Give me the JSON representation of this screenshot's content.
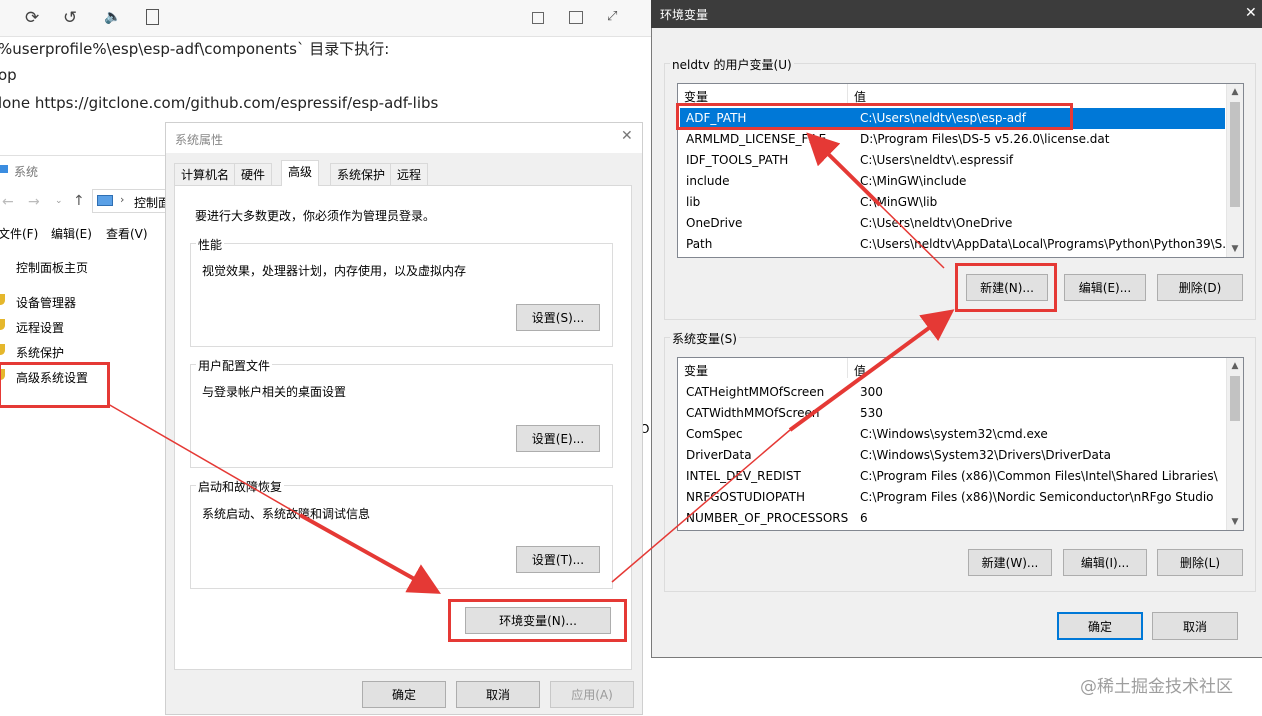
{
  "editor": {
    "toolbar_icons": [
      "refresh-icon",
      "undo-icon",
      "speaker-icon",
      "document-icon",
      "save-icon",
      "split-view-icon",
      "fullscreen-icon"
    ],
    "lines": [
      "%userprofile%\\esp\\esp-adf\\components` 目录下执行:",
      "op",
      "lone https://gitclone.com/github.com/espressif/esp-adf-libs"
    ]
  },
  "control_panel": {
    "title": "系统",
    "address": "控制面",
    "menu": [
      "文件(F)",
      "编辑(E)",
      "查看(V)"
    ],
    "home": "控制面板主页",
    "links": [
      "设备管理器",
      "远程设置",
      "系统保护",
      "高级系统设置"
    ],
    "stray_text": "O"
  },
  "sysprops": {
    "title": "系统属性",
    "tabs": [
      "计算机名",
      "硬件",
      "高级",
      "系统保护",
      "远程"
    ],
    "active_tab": "高级",
    "admin_note": "要进行大多数更改，你必须作为管理员登录。",
    "performance": {
      "title": "性能",
      "desc": "视觉效果，处理器计划，内存使用，以及虚拟内存",
      "button": "设置(S)..."
    },
    "profiles": {
      "title": "用户配置文件",
      "desc": "与登录帐户相关的桌面设置",
      "button": "设置(E)..."
    },
    "startup": {
      "title": "启动和故障恢复",
      "desc": "系统启动、系统故障和调试信息",
      "button": "设置(T)..."
    },
    "env_button": "环境变量(N)...",
    "ok": "确定",
    "cancel": "取消",
    "apply": "应用(A)"
  },
  "envvars": {
    "title": "环境变量",
    "user_group": "neldtv 的用户变量(U)",
    "col_var": "变量",
    "col_val": "值",
    "user_vars": [
      {
        "name": "ADF_PATH",
        "value": "C:\\Users\\neldtv\\esp\\esp-adf"
      },
      {
        "name": "ARMLMD_LICENSE_FILE",
        "value": "D:\\Program Files\\DS-5 v5.26.0\\license.dat"
      },
      {
        "name": "IDF_TOOLS_PATH",
        "value": "C:\\Users\\neldtv\\.espressif"
      },
      {
        "name": "include",
        "value": "C:\\MinGW\\include"
      },
      {
        "name": "lib",
        "value": "C:\\MinGW\\lib"
      },
      {
        "name": "OneDrive",
        "value": "C:\\Users\\neldtv\\OneDrive"
      },
      {
        "name": "Path",
        "value": "C:\\Users\\neldtv\\AppData\\Local\\Programs\\Python\\Python39\\S..."
      }
    ],
    "user_buttons": {
      "new": "新建(N)...",
      "edit": "编辑(E)...",
      "delete": "删除(D)"
    },
    "sys_group": "系统变量(S)",
    "sys_vars": [
      {
        "name": "CATHeightMMOfScreen",
        "value": "300"
      },
      {
        "name": "CATWidthMMOfScreen",
        "value": "530"
      },
      {
        "name": "ComSpec",
        "value": "C:\\Windows\\system32\\cmd.exe"
      },
      {
        "name": "DriverData",
        "value": "C:\\Windows\\System32\\Drivers\\DriverData"
      },
      {
        "name": "INTEL_DEV_REDIST",
        "value": "C:\\Program Files (x86)\\Common Files\\Intel\\Shared Libraries\\"
      },
      {
        "name": "NRFGOSTUDIOPATH",
        "value": "C:\\Program Files (x86)\\Nordic Semiconductor\\nRFgo Studio"
      },
      {
        "name": "NUMBER_OF_PROCESSORS",
        "value": "6"
      }
    ],
    "sys_buttons": {
      "new": "新建(W)...",
      "edit": "编辑(I)...",
      "delete": "删除(L)"
    },
    "ok": "确定",
    "cancel": "取消",
    "close": "✕"
  },
  "watermark": "@稀土掘金技术社区",
  "colors": {
    "highlight": "#e53935",
    "selection": "#0078d7",
    "title_bar": "#3c3c3c"
  }
}
